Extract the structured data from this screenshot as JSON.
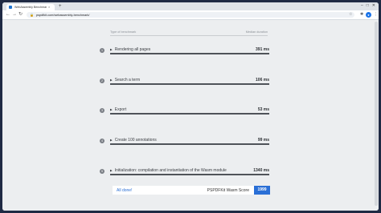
{
  "browser": {
    "tab_title": "WebAssembly Benchmark",
    "tab_close_icon": "×",
    "new_tab_icon": "+",
    "url": "pspdfkit.com/webassembly-benchmark/",
    "window_controls": [
      "–",
      "□",
      "✕"
    ]
  },
  "table": {
    "header_left": "Type of benchmark",
    "header_right": "Median duration"
  },
  "benchmarks": [
    {
      "index": "1",
      "name": "Rendering all pages",
      "duration": "391 ms"
    },
    {
      "index": "2",
      "name": "Search a term",
      "duration": "106 ms"
    },
    {
      "index": "3",
      "name": "Export",
      "duration": "53 ms"
    },
    {
      "index": "4",
      "name": "Create 100 annotations",
      "duration": "99 ms"
    },
    {
      "index": "5",
      "name": "Initialization: compilation and instantiation of the Wasm module",
      "duration": "1340 ms"
    }
  ],
  "result": {
    "status": "All done!",
    "score_label": "PSPDFKit Wasm Score",
    "score_value": "1999"
  },
  "colors": {
    "accent": "#2a6fd6",
    "page_bg": "#eceef0",
    "desktop_bg": "#1f2a44"
  }
}
